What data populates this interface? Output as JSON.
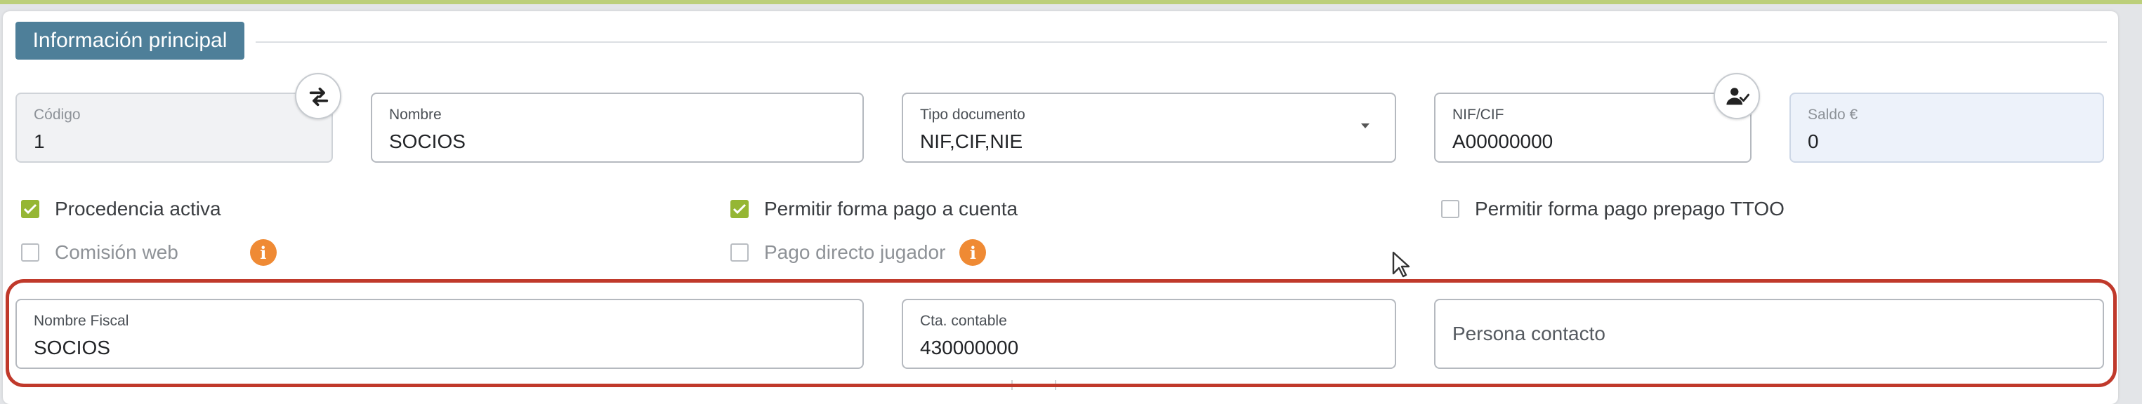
{
  "section": {
    "title": "Información principal"
  },
  "fields": {
    "codigo": {
      "label": "Código",
      "value": "1"
    },
    "nombre": {
      "label": "Nombre",
      "value": "SOCIOS"
    },
    "tipo_documento": {
      "label": "Tipo documento",
      "value": "NIF,CIF,NIE"
    },
    "nif_cif": {
      "label": "NIF/CIF",
      "value": "A00000000"
    },
    "saldo": {
      "label": "Saldo €",
      "value": "0"
    },
    "nombre_fiscal": {
      "label": "Nombre Fiscal",
      "value": "SOCIOS"
    },
    "cta_contable": {
      "label": "Cta. contable",
      "value": "430000000"
    },
    "persona_contacto": {
      "placeholder": "Persona contacto",
      "value": ""
    }
  },
  "checkboxes": {
    "procedencia_activa": {
      "label": "Procedencia activa",
      "checked": true
    },
    "permitir_pago_cuenta": {
      "label": "Permitir forma pago a cuenta",
      "checked": true
    },
    "permitir_pago_prepago": {
      "label": "Permitir forma pago prepago TTOO",
      "checked": false
    },
    "comision_web": {
      "label": "Comisión web",
      "checked": false,
      "disabled": true
    },
    "pago_directo_jugador": {
      "label": "Pago directo jugador",
      "checked": false,
      "disabled": true
    }
  },
  "icons": {
    "swap": "swap-arrows-icon",
    "user_check": "user-check-icon",
    "info": "info-icon",
    "dropdown": "chevron-down-icon",
    "check": "check-icon",
    "cursor": "mouse-cursor-icon"
  },
  "info_glyph": "i",
  "colors": {
    "section_tab": "#4e7f99",
    "checkbox_on": "#95b634",
    "info_badge": "#ef8a34",
    "highlight": "#c0392b",
    "readonly_bg": "#f1f2f4",
    "saldo_bg": "#edf2fa"
  }
}
